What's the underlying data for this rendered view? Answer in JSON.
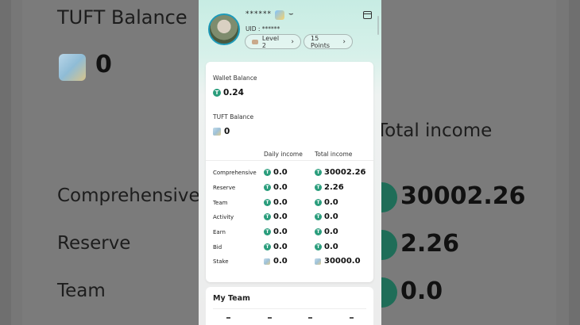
{
  "backdrop": {
    "left_title": "TUFT Balance",
    "left_balance": "0",
    "left_rows": [
      "Comprehensive",
      "Reserve",
      "Team"
    ],
    "right_title": "Total income",
    "right_values": [
      "30002.26",
      "2.26",
      "0.0"
    ]
  },
  "profile": {
    "name": "******",
    "uid_label": "UID : ******",
    "level_label": "Level 2",
    "points_label": "15 Points"
  },
  "wallet": {
    "wallet_label": "Wallet Balance",
    "wallet_value": "0.24",
    "tuft_label": "TUFT Balance",
    "tuft_value": "0"
  },
  "income_table": {
    "col_daily": "Daily income",
    "col_total": "Total income",
    "rows": [
      {
        "label": "Comprehensive",
        "daily": "0.0",
        "total": "30002.26"
      },
      {
        "label": "Reserve",
        "daily": "0.0",
        "total": "2.26"
      },
      {
        "label": "Team",
        "daily": "0.0",
        "total": "0.0"
      },
      {
        "label": "Activity",
        "daily": "0.0",
        "total": "0.0"
      },
      {
        "label": "Earn",
        "daily": "0.0",
        "total": "0.0"
      },
      {
        "label": "Bid",
        "daily": "0.0",
        "total": "0.0"
      },
      {
        "label": "Stake",
        "daily": "0.0",
        "total": "30000.0"
      }
    ]
  },
  "my_team": {
    "title": "My Team"
  },
  "colors": {
    "accent": "#2a9d7c",
    "header_mint": "#c7ece3"
  }
}
